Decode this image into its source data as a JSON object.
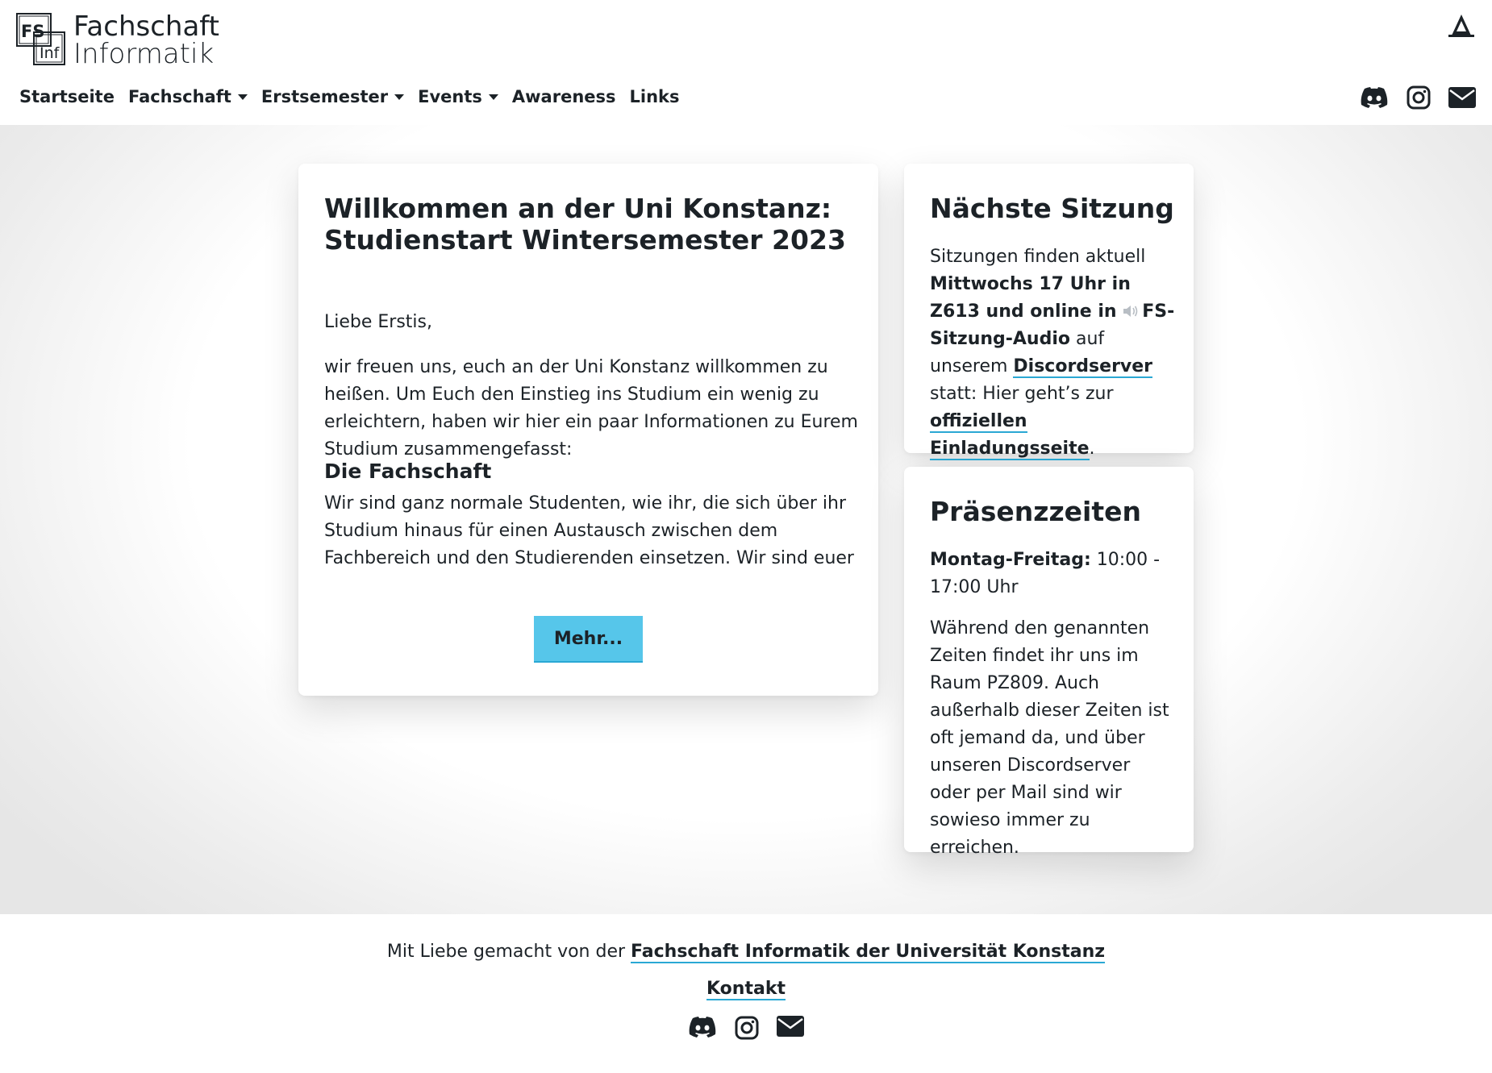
{
  "header": {
    "logo_box_top": "FS",
    "logo_box_bottom": "Inf",
    "logo_line1": "Fachschaft",
    "logo_line2": "Informatik",
    "toggle_icon": "theme-toggle-icon"
  },
  "nav": [
    {
      "label": "Startseite",
      "dropdown": false
    },
    {
      "label": "Fachschaft",
      "dropdown": true
    },
    {
      "label": "Erstsemester",
      "dropdown": true
    },
    {
      "label": "Events",
      "dropdown": true
    },
    {
      "label": "Awareness",
      "dropdown": false
    },
    {
      "label": "Links",
      "dropdown": false
    }
  ],
  "social_icons": [
    "discord-icon",
    "instagram-icon",
    "mail-icon"
  ],
  "main_card": {
    "title": "Willkommen an der Uni Konstanz: Studienstart Wintersemester 2023",
    "greeting": "Liebe Erstis,",
    "intro": "wir freuen uns, euch an der Uni Konstanz willkommen zu heißen. Um Euch den Einstieg ins Studium ein wenig zu erleichtern, haben wir hier ein paar Informationen zu Eurem Studium zusammengefasst:",
    "section_title": "Die Fachschaft",
    "section_text": "Wir sind ganz normale Studenten, wie ihr, die sich über ihr Studium hinaus für einen Austausch zwischen dem Fachbereich und den Studierenden einsetzen. Wir sind euer Ansprechpartner",
    "button_label": "Mehr..."
  },
  "sitzung_card": {
    "title": "Nächste Sitzung",
    "text_a": "Sitzungen finden aktuell ",
    "bold_a": "Mittwochs 17 Uhr in Z613 und online in ",
    "bold_b": "FS-Sitzung-Audio",
    "text_b": " auf unserem ",
    "link_discord": "Discordserver",
    "text_c": " statt: Hier geht’s zur ",
    "link_invite": "offiziellen Einladungsseite",
    "text_d": "."
  },
  "praesenz_card": {
    "title": "Präsenzzeiten",
    "label": "Montag-Freitag:",
    "hours": " 10:00 - 17:00 Uhr",
    "text": "Während den genannten Zeiten findet ihr uns im Raum PZ809. Auch außerhalb dieser Zeiten ist oft jemand da, und über unseren Discordserver oder per Mail sind wir sowieso immer zu erreichen."
  },
  "footer": {
    "made_by": "Mit Liebe gemacht von der ",
    "made_by_link": "Fachschaft Informatik der Universität Konstanz",
    "contact": "Kontakt"
  },
  "colors": {
    "text": "#1c2227",
    "accent": "#56c6ea",
    "link_underline": "#2aa8d4"
  }
}
